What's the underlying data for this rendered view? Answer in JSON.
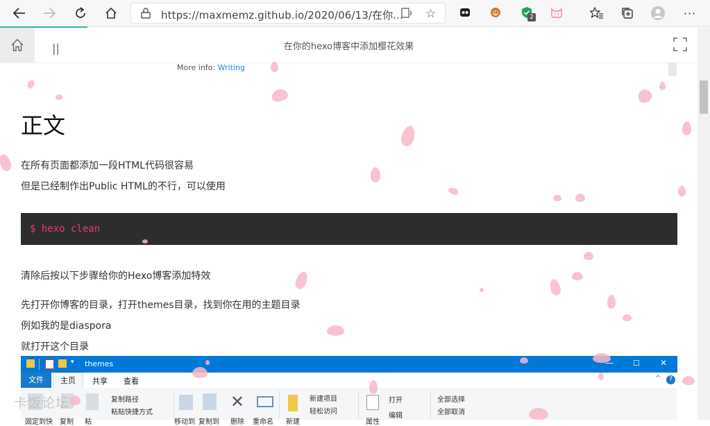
{
  "browser": {
    "url": "https://maxmemz.github.io/2020/06/13/在你...",
    "badge_count": "2"
  },
  "page": {
    "title": "在你的hexo博客中添加樱花效果"
  },
  "article": {
    "more_info_label": "More info:",
    "more_info_link": "Writing",
    "heading": "正文",
    "para1": "在所有页面都添加一段HTML代码很容易",
    "para2": "但是已经制作出Public HTML的不行，可以使用",
    "code": "$ hexo clean",
    "para3": "清除后按以下步骤给你的Hexo博客添加特效",
    "para4": "先打开你博客的目录，打开themes目录，找到你在用的主题目录",
    "para5": "例如我的是diaspora",
    "para6": "就打开这个目录"
  },
  "explorer": {
    "title": "themes",
    "tabs": [
      "文件",
      "主页",
      "共享",
      "查看"
    ],
    "ribbon": {
      "copy_path": "复制路径",
      "paste_shortcut": "粘贴快捷方式",
      "new_item": "新建项目",
      "easy_access": "轻松访问",
      "open": "打开",
      "edit": "编辑",
      "select_all": "全部选择",
      "select_none": "全部取消",
      "pin": "固定到快",
      "copy": "复制",
      "paste": "粘",
      "move_to": "移动到",
      "copy_to": "复制到",
      "delete": "删除",
      "rename": "重命名",
      "new": "新建",
      "properties": "属性"
    }
  },
  "watermark": "卡饭论坛",
  "colors": {
    "accent": "#2cb3a6",
    "link": "#1e88e5",
    "code_bg": "#2d2d2d",
    "code_text": "#e5397b",
    "explorer_blue": "#0078d7",
    "petal": "#f7b9c8"
  }
}
